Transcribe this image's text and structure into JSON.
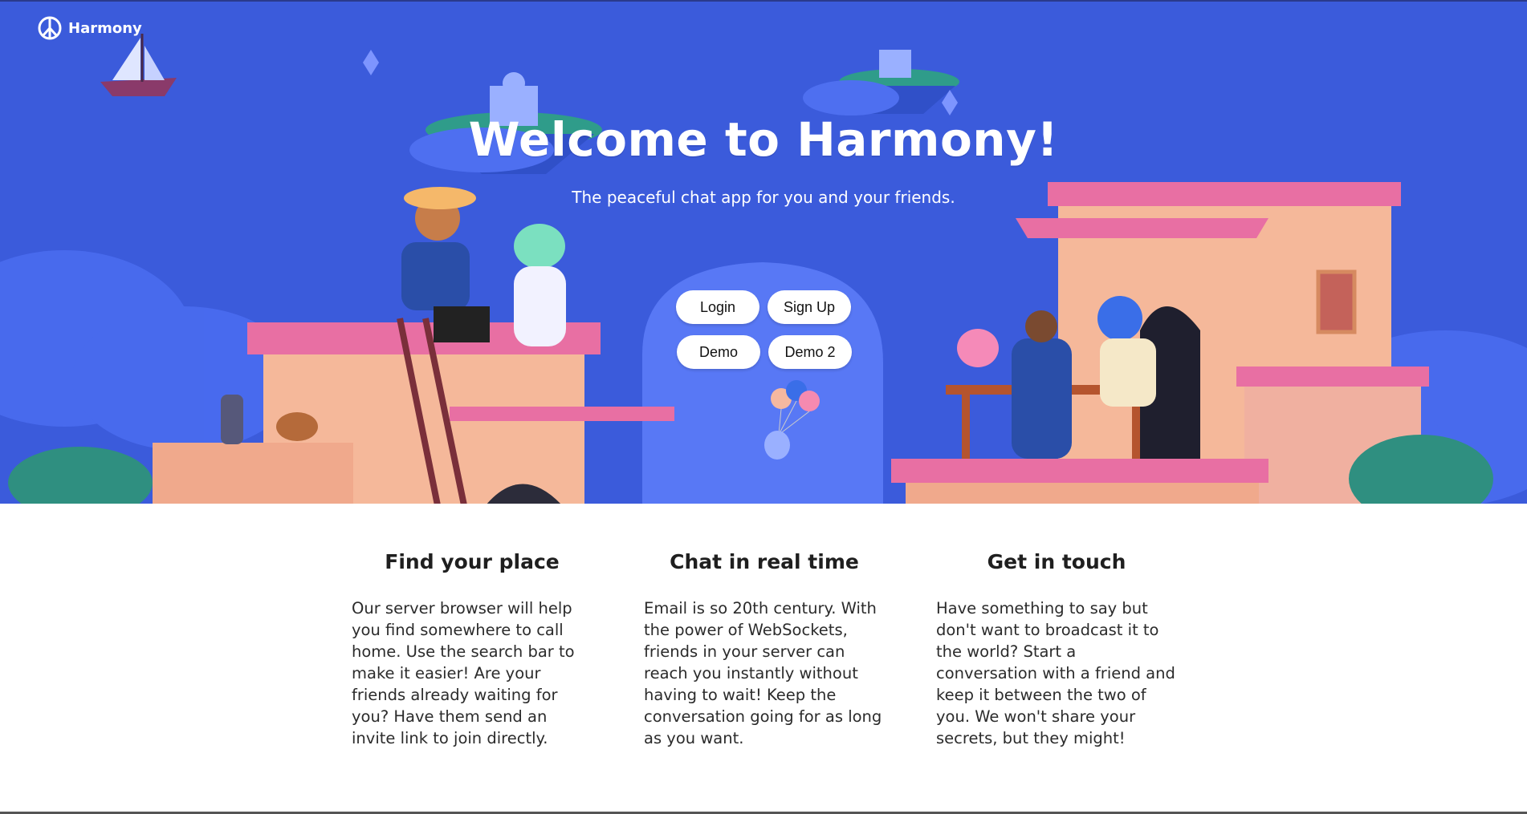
{
  "brand": {
    "name": "Harmony"
  },
  "hero": {
    "title": "Welcome to Harmony!",
    "subtitle": "The peaceful chat app for you and your friends."
  },
  "buttons": {
    "login": "Login",
    "signup": "Sign Up",
    "demo": "Demo",
    "demo2": "Demo 2"
  },
  "features": [
    {
      "title": "Find your place",
      "body": "Our server browser will help you find somewhere to call home. Use the search bar to make it easier! Are your friends already waiting for you? Have them send an invite link to join directly."
    },
    {
      "title": "Chat in real time",
      "body": "Email is so 20th century. With the power of WebSockets, friends in your server can reach you instantly without having to wait! Keep the conversation going for as long as you want."
    },
    {
      "title": "Get in touch",
      "body": "Have something to say but don't want to broadcast it to the world? Start a conversation with a friend and keep it between the two of you. We won't share your secrets, but they might!"
    }
  ],
  "colors": {
    "hero_bg": "#3b5bdb",
    "button_bg": "#ffffff",
    "building_pink": "#e86fa3",
    "building_peach": "#f5b89a"
  },
  "icons": [
    "peace-icon"
  ]
}
